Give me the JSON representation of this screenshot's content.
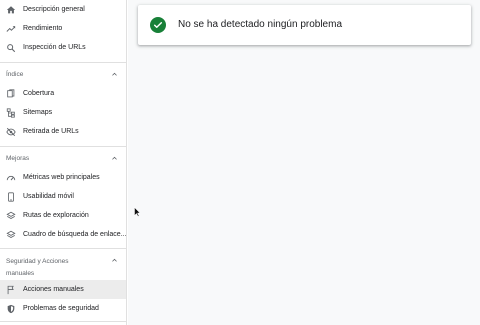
{
  "colors": {
    "accent_green": "#188038",
    "icon_gray": "#5f6368"
  },
  "sidebar": {
    "top_items": [
      {
        "label": "Descripción general",
        "icon": "home-icon"
      },
      {
        "label": "Rendimiento",
        "icon": "trending-up-icon"
      },
      {
        "label": "Inspección de URLs",
        "icon": "search-icon"
      }
    ],
    "sections": [
      {
        "title": "Índice",
        "items": [
          {
            "label": "Cobertura",
            "icon": "file-copy-icon"
          },
          {
            "label": "Sitemaps",
            "icon": "sitemap-icon"
          },
          {
            "label": "Retirada de URLs",
            "icon": "eye-off-icon"
          }
        ]
      },
      {
        "title": "Mejoras",
        "items": [
          {
            "label": "Métricas web principales",
            "icon": "speed-gauge-icon"
          },
          {
            "label": "Usabilidad móvil",
            "icon": "smartphone-icon"
          },
          {
            "label": "Rutas de exploración",
            "icon": "layers-icon"
          },
          {
            "label": "Cuadro de búsqueda de enlace...",
            "icon": "search-box-icon"
          }
        ]
      },
      {
        "title": "Seguridad y Acciones manuales",
        "title_line1": "Seguridad y Acciones",
        "title_line2": "manuales",
        "items": [
          {
            "label": "Acciones manuales",
            "icon": "flag-icon",
            "selected": true
          },
          {
            "label": "Problemas de seguridad",
            "icon": "shield-icon"
          }
        ]
      }
    ]
  },
  "main": {
    "status_message": "No se ha detectado ningún problema",
    "status_icon": "check-circle-icon"
  }
}
